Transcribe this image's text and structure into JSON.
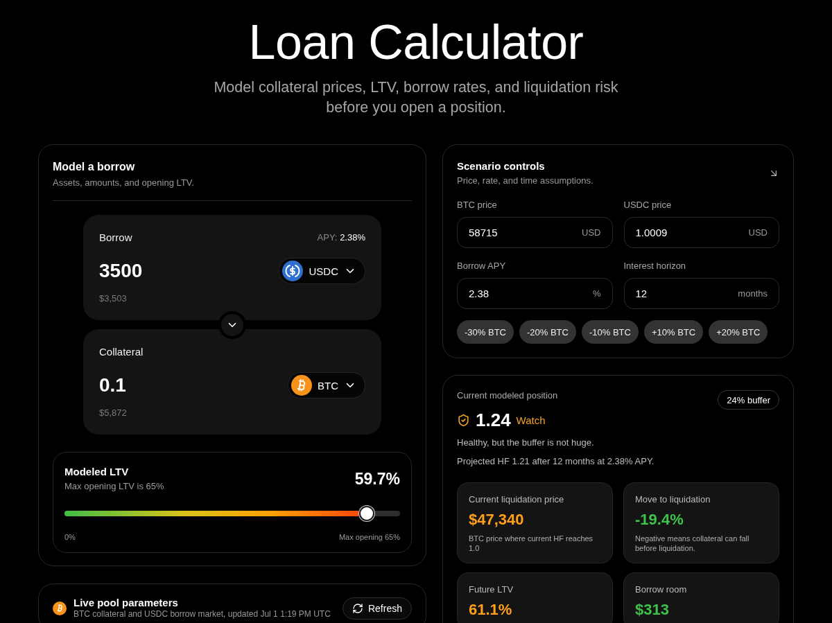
{
  "header": {
    "title": "Loan Calculator",
    "subtitle": "Model collateral prices, LTV, borrow rates, and liquidation risk before you open a position."
  },
  "borrow_panel": {
    "title": "Model a borrow",
    "subtitle": "Assets, amounts, and opening LTV.",
    "assets": [
      {
        "kind": "borrow",
        "label": "Borrow",
        "apy_label": "APY:",
        "apy_value": "2.38%",
        "amount": "3500",
        "usd_value": "$3,503",
        "token": "USDC"
      },
      {
        "kind": "collateral",
        "label": "Collateral",
        "amount": "0.1",
        "usd_value": "$5,872",
        "token": "BTC"
      }
    ],
    "ltv": {
      "title": "Modeled LTV",
      "subtitle": "Max opening LTV is 65%",
      "value": "59.7%",
      "level": 0.9,
      "min_label": "0%",
      "max_label": "Max opening 65%"
    }
  },
  "pool_panel": {
    "title": "Live pool parameters",
    "subtitle": "BTC collateral and USDC borrow market, updated Jul 1 1:19 PM UTC",
    "refresh": "Refresh"
  },
  "scenario_panel": {
    "title": "Scenario controls",
    "subtitle": "Price, rate, and time assumptions.",
    "fields": [
      {
        "label": "BTC price",
        "value": "58715",
        "unit": "USD"
      },
      {
        "label": "USDC price",
        "value": "1.0009",
        "unit": "USD"
      },
      {
        "label": "Borrow APY",
        "value": "2.38",
        "unit": "%"
      },
      {
        "label": "Interest horizon",
        "value": "12",
        "unit": "months"
      }
    ],
    "presets": [
      "-30% BTC",
      "-20% BTC",
      "-10% BTC",
      "+10% BTC",
      "+20% BTC"
    ]
  },
  "position_panel": {
    "title": "Current modeled position",
    "buffer": "24% buffer",
    "health": {
      "value": "1.24",
      "status": "Watch"
    },
    "notes": [
      "Healthy, but the buffer is not huge.",
      "Projected HF 1.21 after 12 months at 2.38% APY."
    ],
    "metrics": [
      {
        "label": "Current liquidation price",
        "value": "$47,340",
        "color": "#ff9f1c",
        "note": "BTC price where current HF reaches 1.0"
      },
      {
        "label": "Move to liquidation",
        "value": "-19.4%",
        "color": "#3fc24a",
        "note": "Negative means collateral can fall before liquidation."
      },
      {
        "label": "Future LTV",
        "value": "61.1%",
        "color": "#ff9f1c"
      },
      {
        "label": "Borrow room",
        "value": "$313",
        "color": "#3fc24a"
      }
    ]
  }
}
